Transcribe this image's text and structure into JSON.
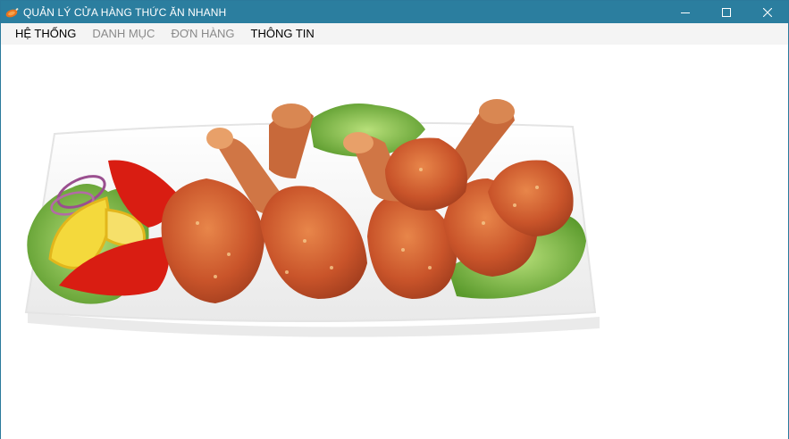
{
  "window": {
    "title": "QUẢN LÝ CỬA HÀNG THỨC ĂN NHANH",
    "app_icon": "chicken-drumstick-icon",
    "controls": {
      "minimize": "minimize-icon",
      "maximize": "maximize-icon",
      "close": "close-icon"
    }
  },
  "menu": {
    "items": [
      {
        "label": "HỆ THỐNG",
        "enabled": true
      },
      {
        "label": "DANH MỤC",
        "enabled": false
      },
      {
        "label": "ĐƠN HÀNG",
        "enabled": false
      },
      {
        "label": "THÔNG TIN",
        "enabled": true
      }
    ]
  },
  "content": {
    "image": "fried-chicken-plate-image"
  },
  "colors": {
    "titlebar": "#2b7e9f",
    "menubar": "#f4f4f4",
    "disabled_text": "#8a8a8a"
  }
}
